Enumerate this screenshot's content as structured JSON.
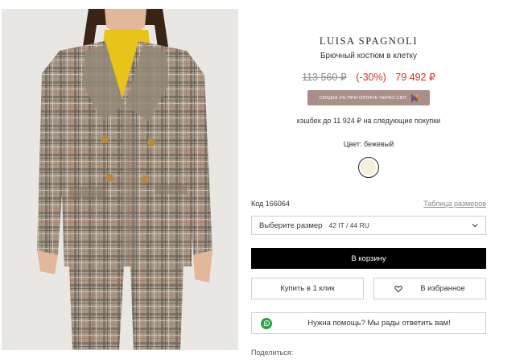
{
  "product": {
    "brand": "LUISA SPAGNOLI",
    "name": "Брючный костюм в клетку",
    "price_old": "113 560 ₽",
    "discount": "(-30%)",
    "price_new": "79 492 ₽",
    "sbp_banner": "СКИДКА 2% ПРИ ОПЛАТЕ ЧЕРЕЗ СБП",
    "cashback": "кэшбек до 11 924 ₽ на следующие покупки",
    "color_label": "Цвет: бежевый",
    "swatch_color": "#f4f0da",
    "sku": "Код 166064",
    "size_table_link": "Таблица размеров"
  },
  "size_select": {
    "label": "Выберите размер",
    "value": "42 IT / 44 RU"
  },
  "actions": {
    "cart": "В корзину",
    "one_click": "Купить в 1 клик",
    "favorite": "В избранное",
    "help": "Нужна помощь? Мы рады ответить вам!",
    "share": "Поделиться:"
  },
  "colors": {
    "accent_red": "#d2302c",
    "banner_bg": "#a98f88",
    "cart_bg": "#000000"
  }
}
